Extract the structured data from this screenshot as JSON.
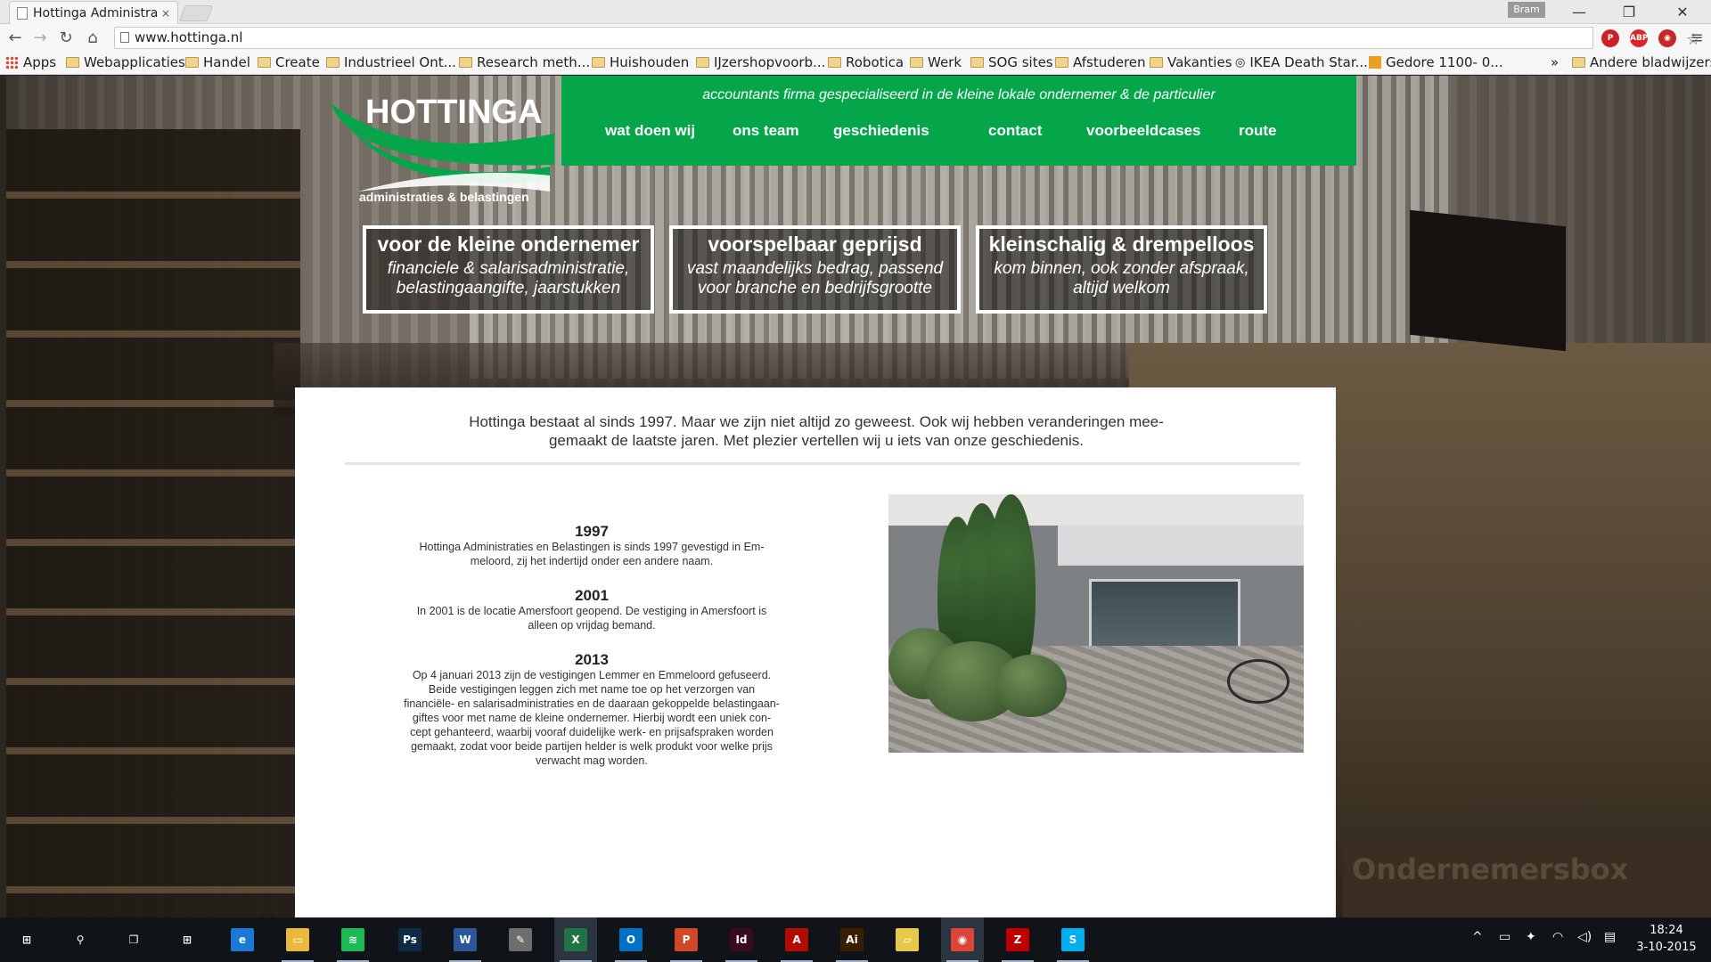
{
  "browser": {
    "tab_title": "Hottinga Administrat",
    "tab_close": "×",
    "profile": "Bram",
    "url": "www.hottinga.nl",
    "window_minimize": "—",
    "window_restore": "❐",
    "window_close": "✕",
    "back": "←",
    "forward": "→",
    "reload": "↻",
    "home": "⌂",
    "star": "☆",
    "menu": "≡",
    "ext_abp": "ABP"
  },
  "bookmarks": {
    "apps": "Apps",
    "items": [
      "Webapplicaties",
      "Handel",
      "Create",
      "Industrieel Ont...",
      "Research meth...",
      "Huishouden",
      "IJzershopvoorb...",
      "Robotica",
      "Werk",
      "SOG sites",
      "Afstuderen",
      "Vakanties",
      "IKEA Death Star...",
      "Gedore 1100- 0..."
    ],
    "overflow": "»",
    "other": "Andere bladwijzers"
  },
  "site": {
    "logo_title": "HOTTINGA",
    "logo_subtitle": "administraties & belastingen",
    "tagline": "accountants firma gespecialiseerd in de kleine lokale ondernemer & de particulier",
    "nav": [
      "wat doen wij",
      "ons team",
      "geschiedenis",
      "contact",
      "voorbeeldcases",
      "route"
    ],
    "features": [
      {
        "title": "voor de kleine ondernemer",
        "line1": "financiele & salarisadministratie,",
        "line2": "belastingaangifte, jaarstukken"
      },
      {
        "title": "voorspelbaar geprijsd",
        "line1": "vast maandelijks bedrag, passend",
        "line2": "voor branche en bedrijfsgrootte"
      },
      {
        "title": "kleinschalig & drempelloos",
        "line1": "kom binnen, ook zonder afspraak,",
        "line2": "altijd welkom"
      }
    ],
    "intro_line1": "Hottinga bestaat al sinds 1997. Maar we zijn niet altijd zo geweest. Ook wij hebben veranderingen mee-",
    "intro_line2": "gemaakt de laatste jaren. Met plezier vertellen wij u iets van onze geschiedenis.",
    "history": [
      {
        "year": "1997",
        "lines": [
          "Hottinga Administraties en Belastingen is sinds 1997 gevestigd in Em-",
          "meloord, zij het indertijd onder een andere naam."
        ]
      },
      {
        "year": "2001",
        "lines": [
          "In 2001 is de locatie Amersfoort geopend. De vestiging in Amersfoort is",
          "alleen op vrijdag bemand."
        ]
      },
      {
        "year": "2013",
        "lines": [
          "Op 4 januari 2013 zijn de vestigingen Lemmer en Emmeloord gefuseerd.",
          "Beide vestigingen leggen zich met name toe op het verzorgen van",
          "financiële- en salarisadministraties en de daaraan gekoppelde belastingaan-",
          "giftes voor met name de kleine ondernemer. Hierbij wordt een uniek con-",
          "cept gehanteerd, waarbij vooraf duidelijke werk- en prijsafspraken worden",
          "gemaakt, zodat voor beide partijen helder is welk produkt voor welke prijs",
          "verwacht mag worden."
        ]
      }
    ],
    "background_box_text": "Ondernemersbox",
    "green": "#05a64a"
  },
  "taskbar": {
    "apps": [
      {
        "name": "start-icon",
        "label": "⊞",
        "color": "#101418"
      },
      {
        "name": "search-icon",
        "label": "⚲",
        "color": "#101418"
      },
      {
        "name": "task-view-icon",
        "label": "❐",
        "color": "#101418"
      },
      {
        "name": "store-icon",
        "label": "⊞",
        "color": "#101418"
      },
      {
        "name": "edge-icon",
        "label": "e",
        "color": "#1a78d6"
      },
      {
        "name": "file-explorer-icon",
        "label": "▭",
        "color": "#e8b93a"
      },
      {
        "name": "spotify-icon",
        "label": "≋",
        "color": "#1db954"
      },
      {
        "name": "photoshop-icon",
        "label": "Ps",
        "color": "#0f2a44"
      },
      {
        "name": "word-icon",
        "label": "W",
        "color": "#2b579a"
      },
      {
        "name": "paint-icon",
        "label": "✎",
        "color": "#6d6d6d"
      },
      {
        "name": "excel-icon",
        "label": "X",
        "color": "#217346"
      },
      {
        "name": "outlook-icon",
        "label": "O",
        "color": "#0072c6"
      },
      {
        "name": "powerpoint-icon",
        "label": "P",
        "color": "#d24726"
      },
      {
        "name": "indesign-icon",
        "label": "Id",
        "color": "#3a0a1f"
      },
      {
        "name": "acrobat-icon",
        "label": "A",
        "color": "#b30b00"
      },
      {
        "name": "illustrator-icon",
        "label": "Ai",
        "color": "#3a1e00"
      },
      {
        "name": "sticky-notes-icon",
        "label": "▱",
        "color": "#e8c84a"
      },
      {
        "name": "chrome-icon",
        "label": "◉",
        "color": "#db4437"
      },
      {
        "name": "filezilla-icon",
        "label": "Z",
        "color": "#bf0000"
      },
      {
        "name": "skype-icon",
        "label": "S",
        "color": "#00aff0"
      }
    ],
    "tray": [
      "^",
      "▭",
      "✦",
      "◠",
      "◁)",
      "▤"
    ],
    "time": "18:24",
    "date": "3-10-2015"
  }
}
